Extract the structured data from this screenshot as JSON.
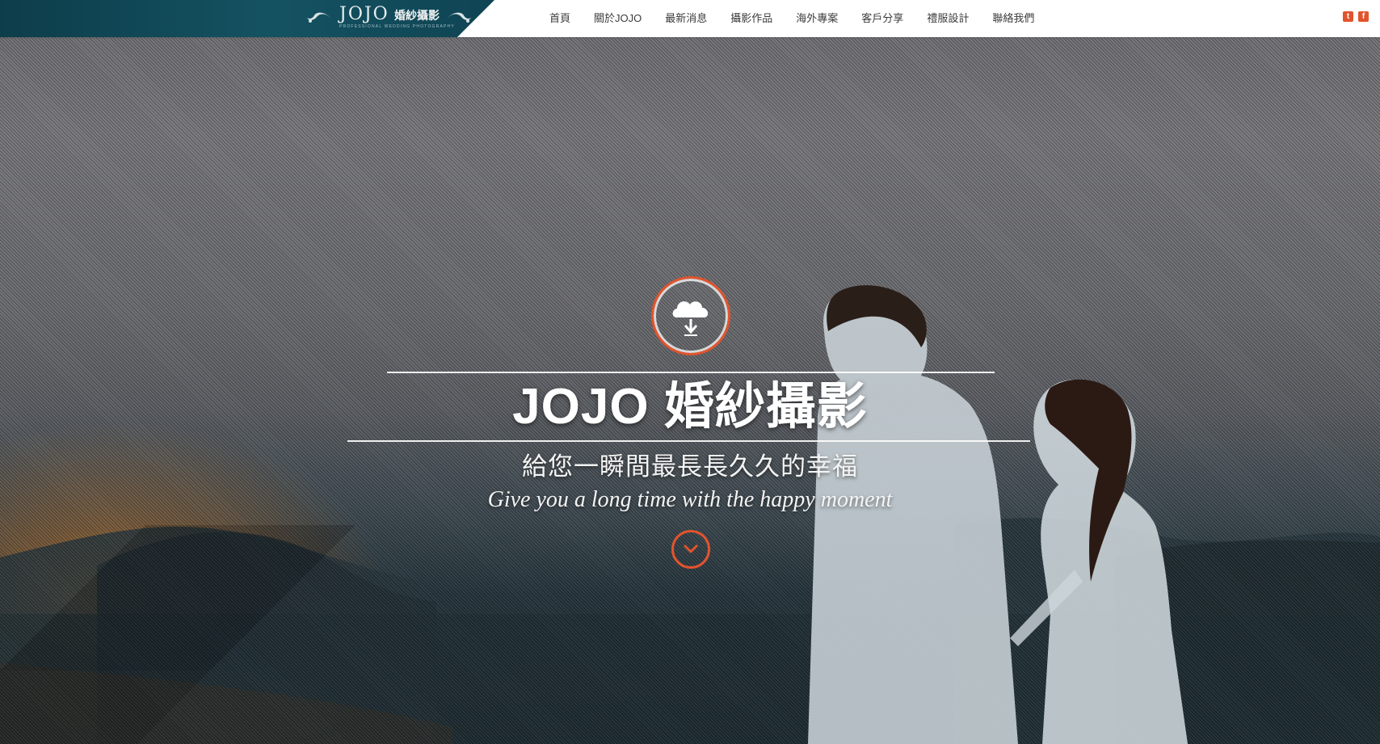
{
  "brand": {
    "logo_wordmark": "JOJO",
    "logo_cn": "婚紗攝影",
    "logo_tagline": "PROFESSIONAL WEDDING PHOTOGRAPHY"
  },
  "nav": {
    "items": [
      {
        "label": "首頁"
      },
      {
        "label": "關於JOJO"
      },
      {
        "label": "最新消息"
      },
      {
        "label": "攝影作品"
      },
      {
        "label": "海外專案"
      },
      {
        "label": "客戶分享"
      },
      {
        "label": "禮服設計"
      },
      {
        "label": "聯絡我們"
      }
    ]
  },
  "social": {
    "twitter_icon": "twitter-icon",
    "facebook_icon": "facebook-icon",
    "twitter_glyph": "t",
    "facebook_glyph": "f"
  },
  "hero": {
    "emblem_icon": "cloud-download-icon",
    "title": "JOJO 婚紗攝影",
    "subtitle": "給您一瞬間最長長久久的幸福",
    "tagline": "Give you a long time with the happy moment",
    "scroll_icon": "chevron-down-icon"
  },
  "colors": {
    "accent": "#e2542d",
    "brand_bar": "#145262",
    "nav_text": "#3b3b3b",
    "header_bg": "#ffffff"
  }
}
